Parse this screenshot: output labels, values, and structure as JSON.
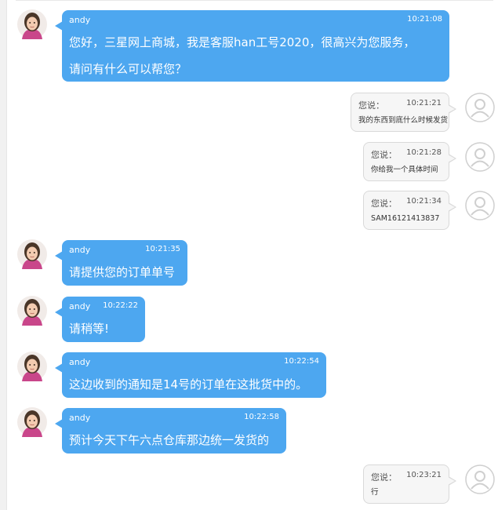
{
  "agent_name": "andy",
  "user_prefix": "您说：",
  "messages": [
    {
      "from": "agent",
      "time": "10:21:08",
      "lines": [
        "您好，三星网上商城，我是客服han工号2020，很高兴为您服务，",
        "请问有什么可以帮您？"
      ]
    },
    {
      "from": "user",
      "time": "10:21:21",
      "text": "我的东西到底什么时候发货"
    },
    {
      "from": "user",
      "time": "10:21:28",
      "text": "你给我一个具体时间"
    },
    {
      "from": "user",
      "time": "10:21:34",
      "text": "SAM16121413837"
    },
    {
      "from": "agent",
      "time": "10:21:35",
      "lines": [
        "请提供您的订单单号"
      ]
    },
    {
      "from": "agent",
      "time": "10:22:22",
      "lines": [
        "请稍等!"
      ]
    },
    {
      "from": "agent",
      "time": "10:22:54",
      "lines": [
        "这边收到的通知是14号的订单在这批货中的。"
      ]
    },
    {
      "from": "agent",
      "time": "10:22:58",
      "lines": [
        "预计今天下午六点仓库那边统一发货的"
      ]
    },
    {
      "from": "user",
      "time": "10:23:21",
      "text": "行"
    }
  ]
}
